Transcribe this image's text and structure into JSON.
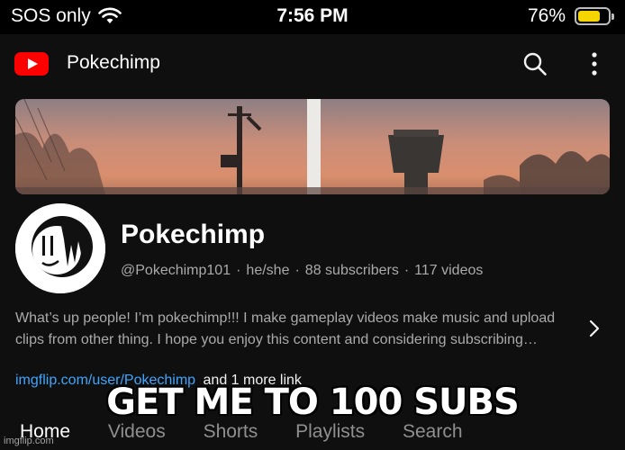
{
  "status_bar": {
    "carrier": "SOS only",
    "time": "7:56 PM",
    "battery_percent": "76%",
    "battery_level": 0.76,
    "battery_color": "#f5d400"
  },
  "header": {
    "logo_icon": "youtube-logo",
    "title": "Pokechimp",
    "icons": [
      "search-icon",
      "more-vertical-icon"
    ],
    "brand_color": "#ff0000"
  },
  "channel": {
    "name": "Pokechimp",
    "handle": "@Pokechimp101",
    "pronouns": "he/she",
    "subscribers": "88 subscribers",
    "videos": "117 videos",
    "description": "What’s up people! I’m pokechimp!!! I make gameplay videos make music and upload clips from other thing. I hope you enjoy this content and considering subscribing…",
    "link_url": "imgflip.com/user/Pokechimp",
    "link_more": "and 1 more link"
  },
  "tabs": [
    {
      "label": "Home",
      "active": true
    },
    {
      "label": "Videos",
      "active": false
    },
    {
      "label": "Shorts",
      "active": false
    },
    {
      "label": "Playlists",
      "active": false
    },
    {
      "label": "Search",
      "active": false
    }
  ],
  "overlay": {
    "caption": "GET ME TO 100 SUBS",
    "watermark": "imgflip.com"
  }
}
